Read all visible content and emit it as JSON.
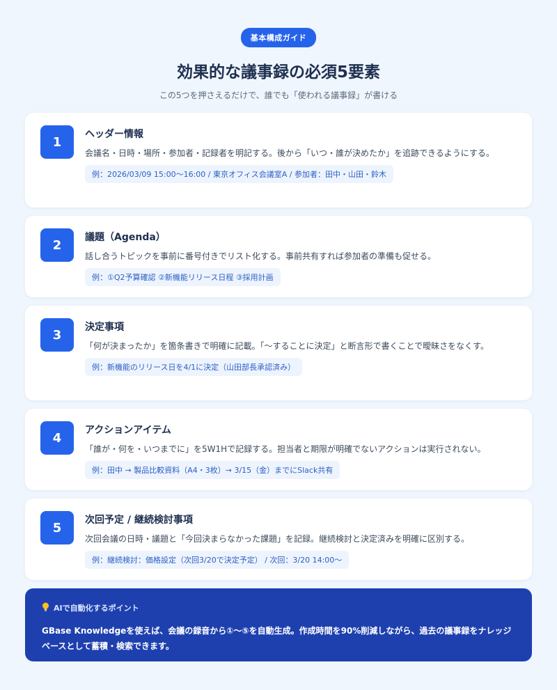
{
  "header": {
    "badge": "基本構成ガイド",
    "title": "効果的な議事録の必須5要素",
    "subtitle": "この5つを押さえるだけで、誰でも「使われる議事録」が書ける"
  },
  "cards": [
    {
      "number": "1",
      "title": "ヘッダー情報",
      "description": "会議名・日時・場所・参加者・記録者を明記する。後から「いつ・誰が決めたか」を追跡できるようにする。",
      "example": "例：2026/03/09 15:00〜16:00 / 東京オフィス会議室A / 参加者：田中・山田・鈴木"
    },
    {
      "number": "2",
      "title": "議題（Agenda）",
      "description": "話し合うトピックを事前に番号付きでリスト化する。事前共有すれば参加者の準備も促せる。",
      "example": "例：①Q2予算確認 ②新機能リリース日程 ③採用計画"
    },
    {
      "number": "3",
      "title": "決定事項",
      "description": "「何が決まったか」を箇条書きで明確に記載。「〜することに決定」と断言形で書くことで曖昧さをなくす。",
      "example": "例：新機能のリリース日を4/1に決定（山田部長承認済み）"
    },
    {
      "number": "4",
      "title": "アクションアイテム",
      "description": "「誰が・何を・いつまでに」を5W1Hで記録する。担当者と期限が明確でないアクションは実行されない。",
      "example": "例：田中 → 製品比較資料（A4・3枚）→ 3/15（金）までにSlack共有"
    },
    {
      "number": "5",
      "title": "次回予定 / 継続検討事項",
      "description": "次回会議の日時・議題と「今回決まらなかった課題」を記録。継続検討と決定済みを明確に区別する。",
      "example": "例：継続検討：価格設定（次回3/20で決定予定） / 次回：3/20 14:00〜"
    }
  ],
  "tip": {
    "icon": "lightbulb-icon",
    "heading": "AIで自動化するポイント",
    "body": "GBase Knowledgeを使えば、会議の録音から①〜⑤を自動生成。作成時間を90%削減しながら、過去の議事録をナレッジベースとして蓄積・検索できます。"
  },
  "colors": {
    "accent": "#2563eb",
    "tip_background": "#1e40af",
    "page_background": "#f0f6fd"
  }
}
